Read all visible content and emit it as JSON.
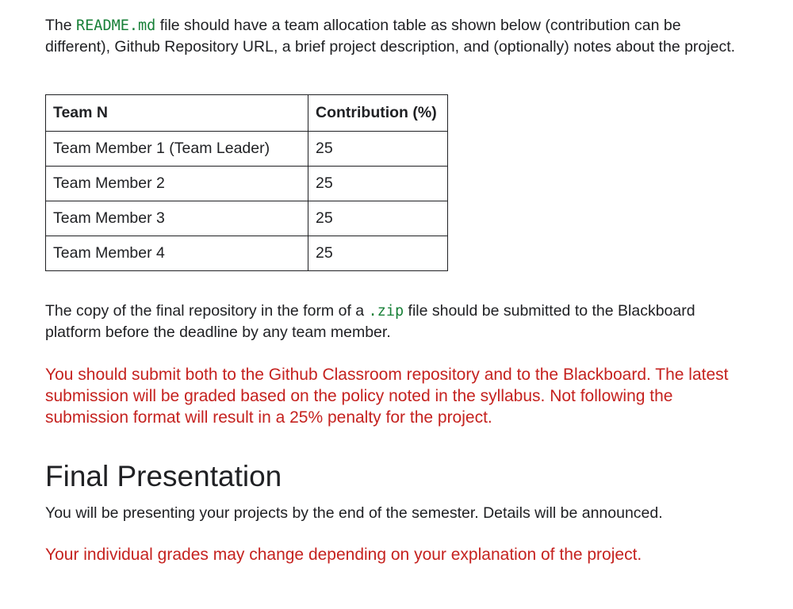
{
  "intro": {
    "before": "The ",
    "code": "README.md",
    "after": "  file should have a team allocation table as shown below (contribution can be different), Github Repository URL, a brief project description, and (optionally) notes about the project."
  },
  "table": {
    "headers": [
      "Team N",
      "Contribution (%)"
    ],
    "rows": [
      [
        "Team Member 1 (Team Leader)",
        "25"
      ],
      [
        "Team Member 2",
        "25"
      ],
      [
        "Team Member 3",
        "25"
      ],
      [
        "Team Member 4",
        "25"
      ]
    ]
  },
  "copy_para": {
    "before": "The copy of the final repository in the form of a ",
    "code": ".zip",
    "after": " file should be submitted to the Blackboard platform before the deadline by any team member."
  },
  "warning": "You should submit both to the Github Classroom repository and to the Blackboard. The latest submission will be graded based on the policy noted in the syllabus. Not following the submission format will result in a 25% penalty for the project.",
  "final_presentation": {
    "heading": "Final Presentation",
    "text": "You will be presenting your projects by the end of the semester. Details will be announced.",
    "note": "Your individual grades may change depending on your explanation of the project."
  },
  "colors": {
    "code": "#188038",
    "warning": "#c5221f",
    "text": "#202124"
  }
}
